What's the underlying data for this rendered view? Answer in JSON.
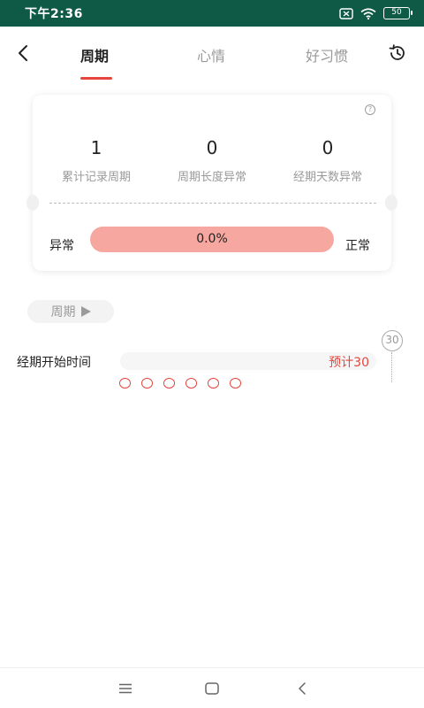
{
  "status_bar": {
    "time": "下午2:36",
    "battery": "50"
  },
  "header": {
    "tabs": [
      {
        "label": "周期",
        "active": true
      },
      {
        "label": "心情",
        "active": false
      },
      {
        "label": "好习惯",
        "active": false
      }
    ]
  },
  "stats": {
    "items": [
      {
        "value": "1",
        "label": "累计记录周期"
      },
      {
        "value": "0",
        "label": "周期长度异常"
      },
      {
        "value": "0",
        "label": "经期天数异常"
      }
    ],
    "abnormal_label": "异常",
    "normal_label": "正常",
    "percent": "0.0%"
  },
  "filter_chip": {
    "label": "周期"
  },
  "period_row": {
    "label": "经期开始时间",
    "expected": "预计30",
    "scale_marker": "30",
    "dot_count": 6
  },
  "colors": {
    "status_bar": "#0e5a46",
    "accent": "#e5453d",
    "bar": "#f6a7a0"
  },
  "icons": {
    "back": "chevron-left-icon",
    "history": "history-icon",
    "help": "question-icon",
    "nav_menu": "menu-icon",
    "nav_home": "home-square-icon",
    "nav_back": "back-chevron-icon"
  }
}
